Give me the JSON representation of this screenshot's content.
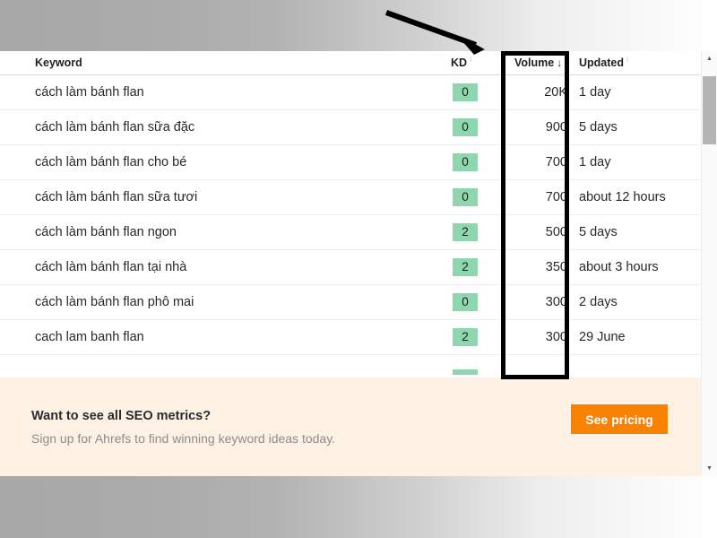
{
  "table": {
    "columns": {
      "keyword": "Keyword",
      "kd": "KD",
      "volume": "Volume",
      "volume_sort_arrow": "↓",
      "updated": "Updated",
      "info_icon": "i"
    },
    "rows": [
      {
        "keyword": "cách làm bánh flan",
        "kd": "0",
        "volume": "20K",
        "updated": "1 day"
      },
      {
        "keyword": "cách làm bánh flan sữa đặc",
        "kd": "0",
        "volume": "900",
        "updated": "5 days"
      },
      {
        "keyword": "cách làm bánh flan cho bé",
        "kd": "0",
        "volume": "700",
        "updated": "1 day"
      },
      {
        "keyword": "cách làm bánh flan sữa tươi",
        "kd": "0",
        "volume": "700",
        "updated": "about 12 hours"
      },
      {
        "keyword": "cách làm bánh flan ngon",
        "kd": "2",
        "volume": "500",
        "updated": "5 days"
      },
      {
        "keyword": "cách làm bánh flan tại nhà",
        "kd": "2",
        "volume": "350",
        "updated": "about 3 hours"
      },
      {
        "keyword": "cách làm bánh flan phô mai",
        "kd": "0",
        "volume": "300",
        "updated": "2 days"
      },
      {
        "keyword": "cach lam banh flan",
        "kd": "2",
        "volume": "300",
        "updated": "29 June"
      }
    ]
  },
  "cta": {
    "title": "Want to see all SEO metrics?",
    "subtitle": "Sign up for Ahrefs to find winning keyword ideas today.",
    "button_label": "See pricing"
  },
  "scrollbar": {
    "up_arrow": "▲",
    "down_arrow": "▼"
  },
  "colors": {
    "kd_badge": "#8ed6ad",
    "cta_background": "#fdf1e3",
    "cta_button": "#f98203",
    "annotation": "#000000"
  }
}
